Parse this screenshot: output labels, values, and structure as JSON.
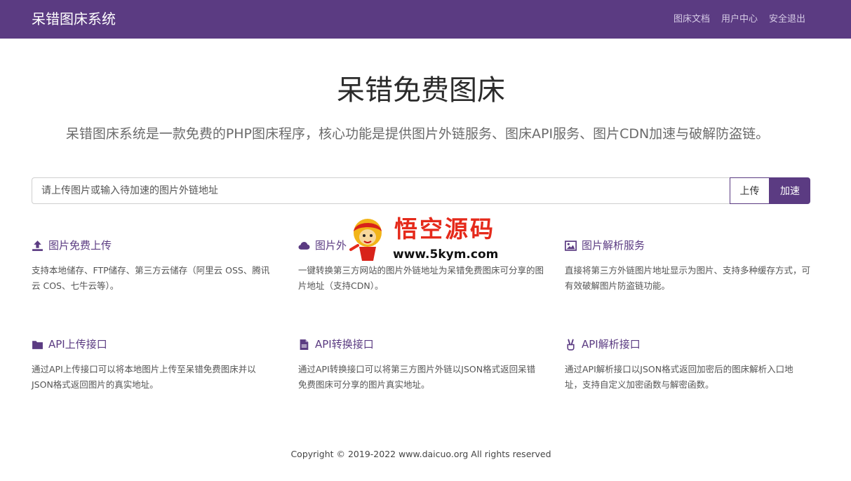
{
  "nav": {
    "brand": "呆错图床系统",
    "links": [
      "图床文档",
      "用户中心",
      "安全退出"
    ]
  },
  "hero": {
    "title": "呆错免费图床",
    "subtitle": "呆错图床系统是一款免费的PHP图床程序，核心功能是提供图片外链服务、图床API服务、图片CDN加速与破解防盗链。"
  },
  "search": {
    "placeholder": "请上传图片或输入待加速的图片外链地址",
    "upload_label": "上传",
    "speed_label": "加速"
  },
  "features": [
    {
      "icon": "upload-icon",
      "title": "图片免费上传",
      "desc": "支持本地储存、FTP储存、第三方云储存（阿里云 OSS、腾讯云 COS、七牛云等）。"
    },
    {
      "icon": "cloud-icon",
      "title": "图片外",
      "desc": "一键转换第三方网站的图片外链地址为呆错免费图床可分享的图片地址（支持CDN）。"
    },
    {
      "icon": "image-icon",
      "title": "图片解析服务",
      "desc": "直接将第三方外链图片地址显示为图片、支持多种缓存方式，可有效破解图片防盗链功能。"
    },
    {
      "icon": "folder-icon",
      "title": "API上传接口",
      "desc": "通过API上传接口可以将本地图片上传至呆错免费图床并以JSON格式返回图片的真实地址。"
    },
    {
      "icon": "file-icon",
      "title": "API转换接口",
      "desc": "通过API转换接口可以将第三方图片外链以JSON格式返回呆错免费图床可分享的图片真实地址。"
    },
    {
      "icon": "victory-hand-icon",
      "title": "API解析接口",
      "desc": "通过API解析接口以JSON格式返回加密后的图床解析入口地址，支持自定义加密函数与解密函数。"
    }
  ],
  "watermark": {
    "title": "悟空源码",
    "url": "www.5kym.com"
  },
  "footer": {
    "copyright": "Copyright © 2019-2022 www.daicuo.org All rights reserved"
  },
  "colors": {
    "brand": "#5b3b82",
    "nav_link": "#d6cbe6",
    "watermark_red": "#e52a1b"
  }
}
